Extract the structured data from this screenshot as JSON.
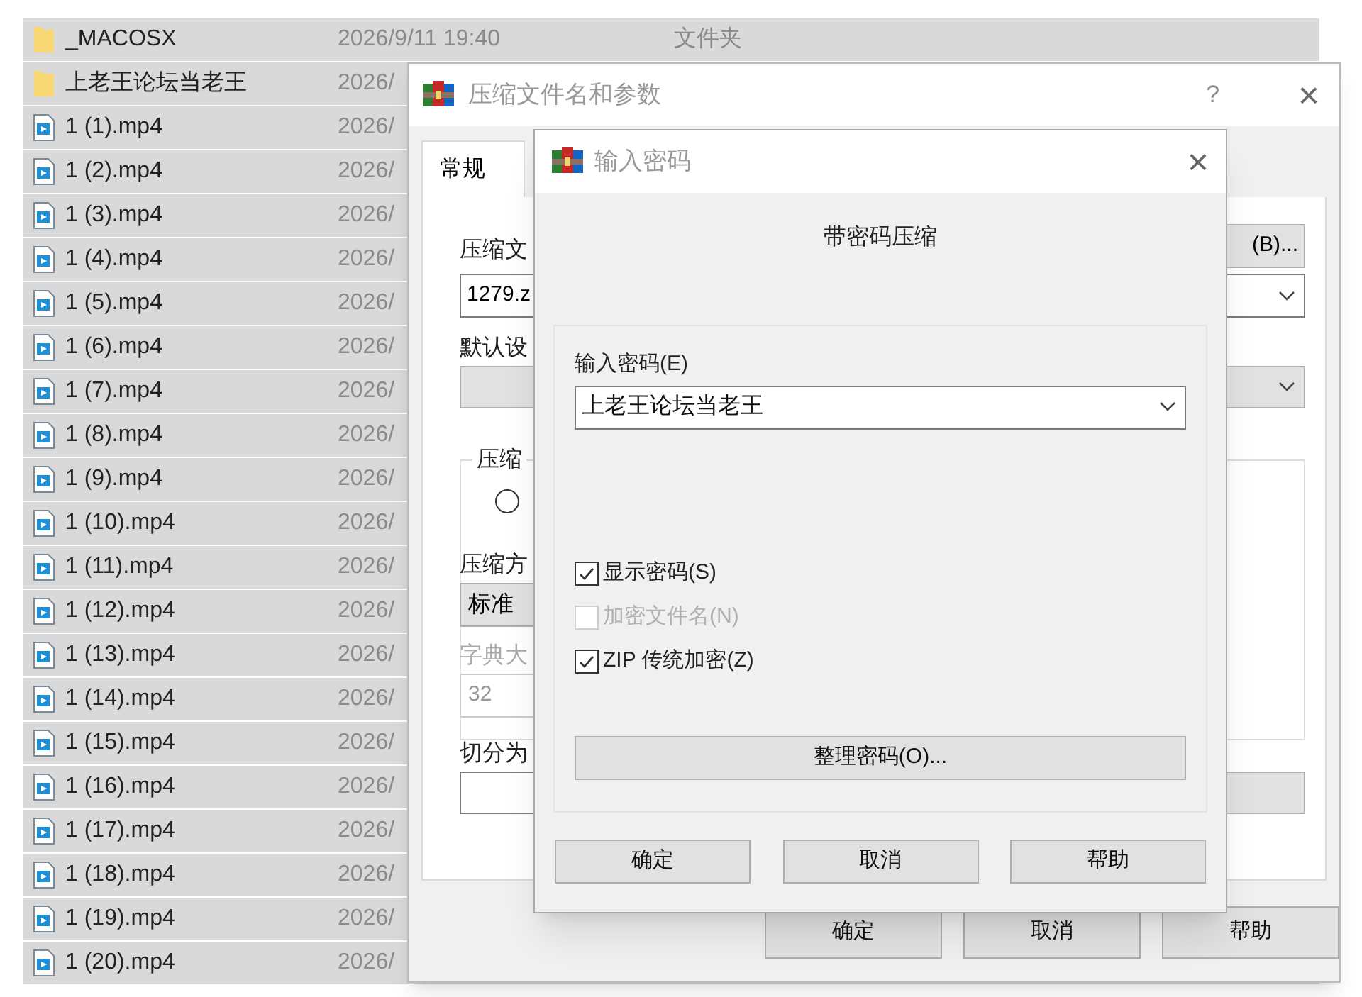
{
  "file_list": {
    "rows": [
      {
        "kind": "folder",
        "name": "_MACOSX",
        "modified": "2026/9/11 19:40",
        "type": "文件夹",
        "selected": true
      },
      {
        "kind": "folder",
        "name": "上老王论坛当老王",
        "modified": "2026/",
        "selected": true
      },
      {
        "kind": "video",
        "name": "1 (1).mp4",
        "modified": "2026/",
        "selected": true
      },
      {
        "kind": "video",
        "name": "1 (2).mp4",
        "modified": "2026/",
        "selected": true
      },
      {
        "kind": "video",
        "name": "1 (3).mp4",
        "modified": "2026/",
        "selected": true
      },
      {
        "kind": "video",
        "name": "1 (4).mp4",
        "modified": "2026/",
        "selected": true
      },
      {
        "kind": "video",
        "name": "1 (5).mp4",
        "modified": "2026/",
        "selected": true
      },
      {
        "kind": "video",
        "name": "1 (6).mp4",
        "modified": "2026/",
        "selected": true
      },
      {
        "kind": "video",
        "name": "1 (7).mp4",
        "modified": "2026/",
        "selected": true
      },
      {
        "kind": "video",
        "name": "1 (8).mp4",
        "modified": "2026/",
        "selected": true
      },
      {
        "kind": "video",
        "name": "1 (9).mp4",
        "modified": "2026/",
        "selected": true
      },
      {
        "kind": "video",
        "name": "1 (10).mp4",
        "modified": "2026/",
        "selected": true
      },
      {
        "kind": "video",
        "name": "1 (11).mp4",
        "modified": "2026/",
        "selected": true
      },
      {
        "kind": "video",
        "name": "1 (12).mp4",
        "modified": "2026/",
        "selected": true
      },
      {
        "kind": "video",
        "name": "1 (13).mp4",
        "modified": "2026/",
        "selected": true
      },
      {
        "kind": "video",
        "name": "1 (14).mp4",
        "modified": "2026/",
        "selected": true
      },
      {
        "kind": "video",
        "name": "1 (15).mp4",
        "modified": "2026/",
        "selected": true
      },
      {
        "kind": "video",
        "name": "1 (16).mp4",
        "modified": "2026/",
        "selected": true
      },
      {
        "kind": "video",
        "name": "1 (17).mp4",
        "modified": "2026/",
        "selected": true
      },
      {
        "kind": "video",
        "name": "1 (18).mp4",
        "modified": "2026/",
        "selected": true
      },
      {
        "kind": "video",
        "name": "1 (19).mp4",
        "modified": "2026/",
        "selected": true
      },
      {
        "kind": "video",
        "name": "1 (20).mp4",
        "modified": "2026/",
        "selected": true
      }
    ]
  },
  "archive_dialog": {
    "title": "压缩文件名和参数",
    "help": "?",
    "close": "×",
    "tabs": [
      {
        "label": "常规",
        "selected": true
      }
    ],
    "archive_name": {
      "label": "压缩文",
      "value": "1279.z"
    },
    "browse_button": "(B)...",
    "profile_label": "默认设",
    "group": {
      "label": "压缩",
      "radio_selected": false
    },
    "method": {
      "label": "压缩方",
      "value": "标准"
    },
    "dictionary": {
      "label": "字典大",
      "value": "32",
      "disabled": true
    },
    "split_label": "切分为",
    "buttons": [
      "确定",
      "取消",
      "帮助"
    ]
  },
  "password_dialog": {
    "title": "输入密码",
    "close": "×",
    "heading": "带密码压缩",
    "password": {
      "label": "输入密码(E)",
      "value": "上老王论坛当老王"
    },
    "options": [
      {
        "label": "显示密码(S)",
        "checked": true,
        "disabled": false
      },
      {
        "label": "加密文件名(N)",
        "checked": false,
        "disabled": true
      },
      {
        "label": "ZIP 传统加密(Z)",
        "checked": true,
        "disabled": false
      }
    ],
    "organize_button": "整理密码(O)...",
    "buttons": [
      "确定",
      "取消",
      "帮助"
    ]
  }
}
